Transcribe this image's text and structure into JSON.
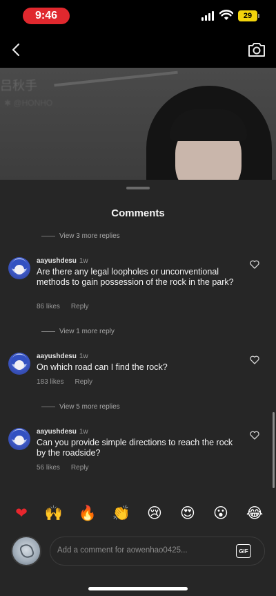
{
  "status": {
    "time": "9:46",
    "battery": "29"
  },
  "video": {
    "caption_line1": "吕秋手",
    "caption_line2": "✱ @HONHO"
  },
  "sheet": {
    "title": "Comments"
  },
  "threads": [
    {
      "view_more": "View 3 more replies"
    },
    {
      "username": "aayushdesu",
      "time": "1w",
      "text": "Are there any legal loopholes or unconventional methods to gain possession of the rock in the park?",
      "likes": "86 likes",
      "reply": "Reply",
      "view_more": "View 1 more reply"
    },
    {
      "username": "aayushdesu",
      "time": "1w",
      "text": "On which road can I find the rock?",
      "likes": "183 likes",
      "reply": "Reply",
      "view_more": "View 5 more replies"
    },
    {
      "username": "aayushdesu",
      "time": "1w",
      "text": "Can you provide simple directions to reach the rock by the roadside?",
      "likes": "56 likes",
      "reply": "Reply"
    }
  ],
  "emojis": [
    {
      "name": "red-heart",
      "glyph": "❤"
    },
    {
      "name": "raising-hands",
      "glyph": "🙌"
    },
    {
      "name": "fire",
      "glyph": "🔥"
    },
    {
      "name": "clapping-hands",
      "glyph": "👏"
    },
    {
      "name": "crying-face",
      "glyph": "😢"
    },
    {
      "name": "heart-eyes-face",
      "glyph": "😍"
    },
    {
      "name": "astonished-face",
      "glyph": "😮"
    },
    {
      "name": "tears-of-joy-face",
      "glyph": "😂"
    }
  ],
  "composer": {
    "placeholder": "Add a comment for aowenhao0425...",
    "gif_label": "GIF"
  },
  "colors": {
    "status_time_bg": "#e0282e",
    "battery": "#f2d40c",
    "sheet_bg": "#262626"
  }
}
